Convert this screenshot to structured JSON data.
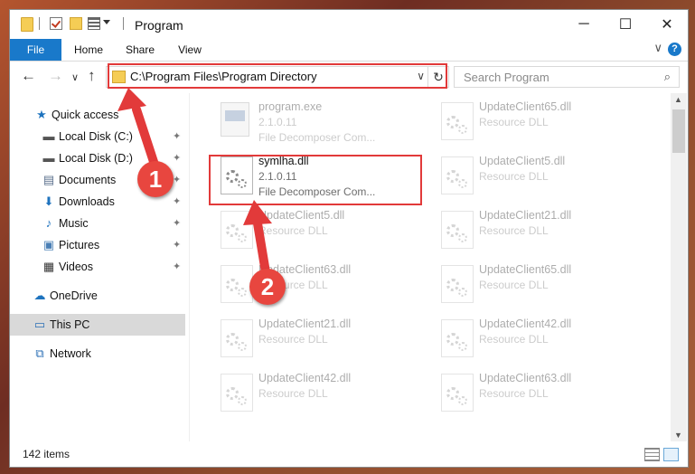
{
  "window": {
    "title": "Program",
    "controls": {
      "minimize": "─",
      "maximize": "☐",
      "close": "✕"
    }
  },
  "ribbon": {
    "tabs": [
      "File",
      "Home",
      "Share",
      "View"
    ],
    "collapse": "∨",
    "help": "?"
  },
  "nav": {
    "back": "←",
    "forward": "→",
    "recent": "∨",
    "up": "↑"
  },
  "address": {
    "path": "C:\\Program Files\\Program Directory",
    "dropdown": "∨",
    "refresh": "↻"
  },
  "search": {
    "placeholder": "Search Program",
    "icon": "⌕"
  },
  "sidebar": {
    "items": [
      {
        "label": "Quick access",
        "icon": "star-icon",
        "glyph": "★",
        "color": "#1e73be",
        "pinned": false
      },
      {
        "label": "Local Disk (C:)",
        "icon": "drive-icon",
        "glyph": "▬",
        "color": "#555555",
        "pinned": true
      },
      {
        "label": "Local Disk (D:)",
        "icon": "drive-icon",
        "glyph": "▬",
        "color": "#555555",
        "pinned": true
      },
      {
        "label": "Documents",
        "icon": "document-icon",
        "glyph": "▤",
        "color": "#5a6f8c",
        "pinned": true
      },
      {
        "label": "Downloads",
        "icon": "download-icon",
        "glyph": "⬇",
        "color": "#1e73be",
        "pinned": true
      },
      {
        "label": "Music",
        "icon": "music-icon",
        "glyph": "♪",
        "color": "#1e73be",
        "pinned": true
      },
      {
        "label": "Pictures",
        "icon": "pictures-icon",
        "glyph": "▣",
        "color": "#4a7fb5",
        "pinned": true
      },
      {
        "label": "Videos",
        "icon": "video-icon",
        "glyph": "▦",
        "color": "#333333",
        "pinned": true
      },
      {
        "label": "OneDrive",
        "icon": "cloud-icon",
        "glyph": "☁",
        "color": "#1e73be",
        "pinned": false
      },
      {
        "label": "This PC",
        "icon": "computer-icon",
        "glyph": "▭",
        "color": "#2b6fb6",
        "pinned": false
      },
      {
        "label": "Network",
        "icon": "network-icon",
        "glyph": "⧉",
        "color": "#2b6fb6",
        "pinned": false
      }
    ],
    "pin_glyph": "📌"
  },
  "files": [
    {
      "name": "program.exe",
      "line2": "2.1.0.11",
      "line3": "File Decomposer Com...",
      "icon": "exe-icon",
      "faded": true
    },
    {
      "name": "UpdateClient65.dll",
      "line2": "Resource DLL",
      "line3": "",
      "icon": "dll-icon",
      "faded": true
    },
    {
      "name": "symlha.dll",
      "line2": "2.1.0.11",
      "line3": "File Decomposer Com...",
      "icon": "dll-icon",
      "faded": false
    },
    {
      "name": "UpdateClient5.dll",
      "line2": "Resource DLL",
      "line3": "",
      "icon": "dll-icon",
      "faded": true
    },
    {
      "name": "UpdateClient5.dll",
      "line2": "Resource DLL",
      "line3": "",
      "icon": "dll-icon",
      "faded": true
    },
    {
      "name": "UpdateClient21.dll",
      "line2": "Resource DLL",
      "line3": "",
      "icon": "dll-icon",
      "faded": true
    },
    {
      "name": "UpdateClient63.dll",
      "line2": "Resource DLL",
      "line3": "",
      "icon": "dll-icon",
      "faded": true
    },
    {
      "name": "UpdateClient65.dll",
      "line2": "Resource DLL",
      "line3": "",
      "icon": "dll-icon",
      "faded": true
    },
    {
      "name": "UpdateClient21.dll",
      "line2": "Resource DLL",
      "line3": "",
      "icon": "dll-icon",
      "faded": true
    },
    {
      "name": "UpdateClient42.dll",
      "line2": "Resource DLL",
      "line3": "",
      "icon": "dll-icon",
      "faded": true
    },
    {
      "name": "UpdateClient42.dll",
      "line2": "Resource DLL",
      "line3": "",
      "icon": "dll-icon",
      "faded": true
    },
    {
      "name": "UpdateClient63.dll",
      "line2": "Resource DLL",
      "line3": "",
      "icon": "dll-icon",
      "faded": true
    }
  ],
  "status": {
    "count": "142 items"
  },
  "annotations": {
    "step1": "1",
    "step2": "2",
    "color": "#e23a3a"
  }
}
